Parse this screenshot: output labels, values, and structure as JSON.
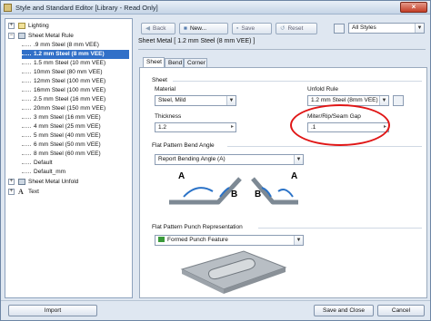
{
  "window": {
    "title": "Style and Standard Editor [Library - Read Only]",
    "close_glyph": "×"
  },
  "toolbar": {
    "back_label": "Back",
    "new_label": "New...",
    "save_label": "Save",
    "reset_label": "Reset",
    "filter_value": "All Styles"
  },
  "tree": {
    "lighting": "Lighting",
    "sheet_metal_rule": "Sheet Metal Rule",
    "rules": [
      ".9 mm Steel (8 mm VEE)",
      "1.2 mm Steel (8 mm VEE)",
      "1.5 mm Steel (10 mm VEE)",
      "10mm Steel (80 mm VEE)",
      "12mm Steel (100 mm VEE)",
      "16mm Steel (100 mm VEE)",
      "2.5 mm Steel (16 mm VEE)",
      "20mm Steel (150 mm VEE)",
      "3 mm Steel (16 mm VEE)",
      "4 mm Steel (25 mm VEE)",
      "5 mm Steel (40 mm VEE)",
      "6 mm Steel (50 mm VEE)",
      "8 mm Steel (60 mm VEE)",
      "Default",
      "Default_mm"
    ],
    "sheet_metal_unfold": "Sheet Metal Unfold",
    "text": "Text",
    "expand_minus": "−",
    "expand_plus": "+"
  },
  "editor": {
    "breadcrumb": "Sheet Metal [ 1.2 mm Steel (8 mm VEE) ]",
    "tabs": [
      "Sheet",
      "Bend",
      "Corner"
    ],
    "sheet_group": "Sheet",
    "material_label": "Material",
    "material_value": "Steel, Mild",
    "thickness_label": "Thickness",
    "thickness_value": "1.2",
    "unfold_rule_label": "Unfold Rule",
    "unfold_rule_value": "1.2 mm Steel (8mm VEE)",
    "miter_gap_label": "Miter/Rip/Seam Gap",
    "miter_gap_value": ".1",
    "flat_pattern_bend_label": "Flat Pattern Bend Angle",
    "bend_angle_value": "Report Bending Angle (A)",
    "diagram_labels": [
      "A",
      "B",
      "B",
      "A"
    ],
    "punch_label": "Flat Pattern Punch Representation",
    "punch_value": "Formed Punch Feature"
  },
  "footer": {
    "import_label": "Import",
    "save_close_label": "Save and Close",
    "cancel_label": "Cancel"
  },
  "colors": {
    "highlight": "#e01616",
    "selection": "#3170c8",
    "arrow": "#2a72c7"
  }
}
